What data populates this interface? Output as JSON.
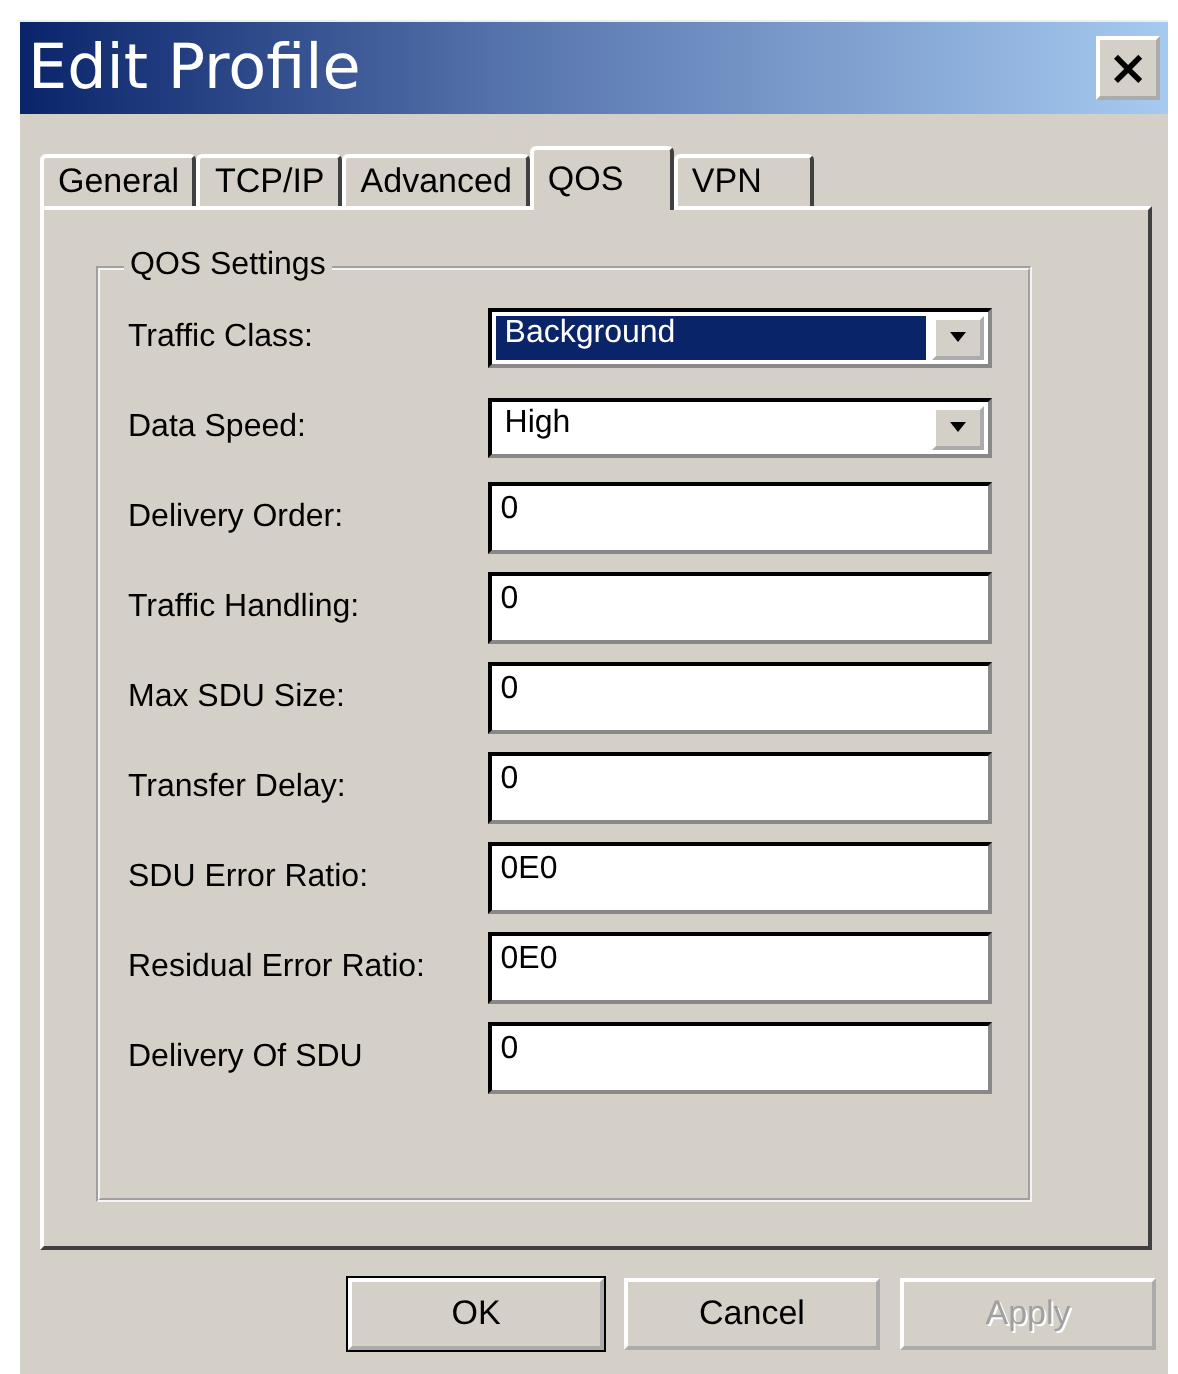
{
  "window": {
    "title": "Edit Profile",
    "close": "×"
  },
  "tabs": [
    {
      "label": "General",
      "selected": false
    },
    {
      "label": "TCP/IP",
      "selected": false
    },
    {
      "label": "Advanced",
      "selected": false
    },
    {
      "label": "QOS",
      "selected": true
    },
    {
      "label": "VPN",
      "selected": false
    }
  ],
  "group": {
    "title": "QOS Settings",
    "fields": [
      {
        "label": "Traffic Class:",
        "kind": "dropdown",
        "value": "Background",
        "highlighted": true
      },
      {
        "label": "Data Speed:",
        "kind": "dropdown",
        "value": "High",
        "highlighted": false
      },
      {
        "label": "Delivery Order:",
        "kind": "text",
        "value": "0"
      },
      {
        "label": "Traffic Handling:",
        "kind": "text",
        "value": "0"
      },
      {
        "label": "Max SDU Size:",
        "kind": "text",
        "value": "0"
      },
      {
        "label": "Transfer Delay:",
        "kind": "text",
        "value": "0"
      },
      {
        "label": "SDU Error Ratio:",
        "kind": "text",
        "value": "0E0"
      },
      {
        "label": "Residual Error Ratio:",
        "kind": "text",
        "value": "0E0"
      },
      {
        "label": "Delivery Of SDU",
        "kind": "text",
        "value": "0"
      }
    ]
  },
  "buttons": [
    {
      "label": "OK",
      "disabled": false,
      "default": true
    },
    {
      "label": "Cancel",
      "disabled": false,
      "default": false
    },
    {
      "label": "Apply",
      "disabled": true,
      "default": false
    }
  ]
}
